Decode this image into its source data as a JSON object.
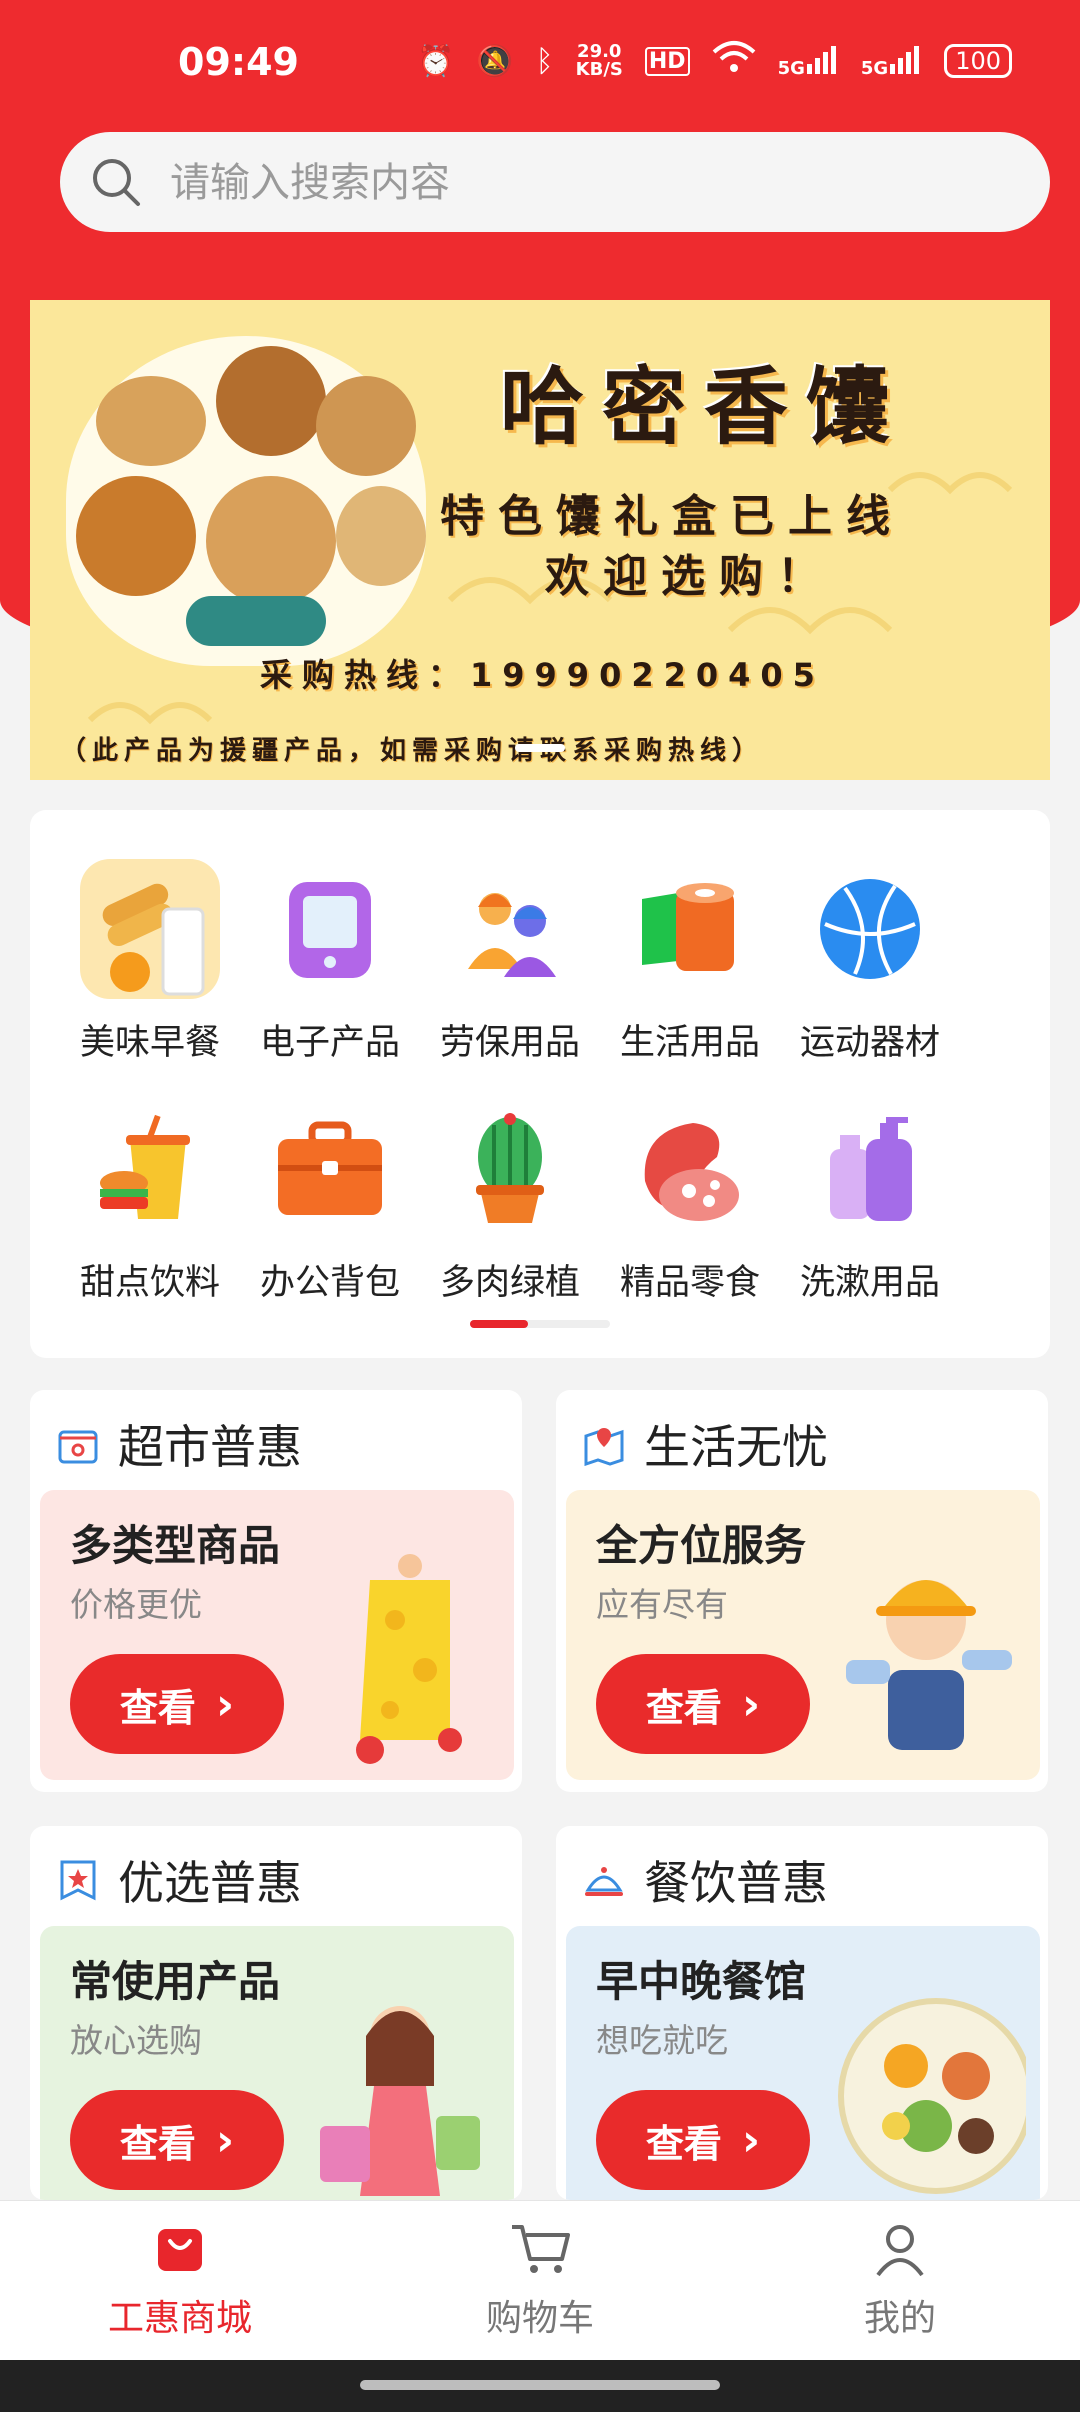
{
  "status": {
    "time": "09:49",
    "net_speed_value": "29.0",
    "net_speed_unit": "KB/S",
    "hd": "HD",
    "sim1": "5G",
    "sim2": "5G",
    "battery": "100"
  },
  "search": {
    "placeholder": "请输入搜索内容"
  },
  "banner": {
    "title": "哈密香馕",
    "line1": "特色馕礼盒已上线",
    "line2": "欢迎选购！",
    "hotline": "采购热线：19990220405",
    "note": "（此产品为援疆产品，如需采购请联系采购热线）"
  },
  "categories": [
    {
      "label": "美味早餐",
      "icon": "breakfast-icon"
    },
    {
      "label": "电子产品",
      "icon": "tablet-icon"
    },
    {
      "label": "劳保用品",
      "icon": "worker-helmet-icon"
    },
    {
      "label": "生活用品",
      "icon": "paper-roll-icon"
    },
    {
      "label": "运动器材",
      "icon": "ball-icon"
    },
    {
      "label": "甜点饮料",
      "icon": "drink-burger-icon"
    },
    {
      "label": "办公背包",
      "icon": "briefcase-icon"
    },
    {
      "label": "多肉绿植",
      "icon": "cactus-icon"
    },
    {
      "label": "精品零食",
      "icon": "meat-snack-icon"
    },
    {
      "label": "洗漱用品",
      "icon": "bottles-icon"
    }
  ],
  "cards": [
    {
      "title": "超市普惠",
      "t1": "多类型商品",
      "t2": "价格更优",
      "btn": "查看",
      "icon": "store-icon",
      "illus": "cheese-illustration"
    },
    {
      "title": "生活无忧",
      "t1": "全方位服务",
      "t2": "应有尽有",
      "btn": "查看",
      "icon": "map-pin-icon",
      "illus": "worker-illustration"
    },
    {
      "title": "优选普惠",
      "t1": "常使用产品",
      "t2": "放心选购",
      "btn": "查看",
      "icon": "bookmark-star-icon",
      "illus": "shopper-illustration"
    },
    {
      "title": "餐饮普惠",
      "t1": "早中晚餐馆",
      "t2": "想吃就吃",
      "btn": "查看",
      "icon": "food-cloche-icon",
      "illus": "salad-plate-illustration"
    }
  ],
  "tabs": [
    {
      "label": "工惠商城",
      "active": true,
      "icon": "shopping-bag-icon"
    },
    {
      "label": "购物车",
      "active": false,
      "icon": "cart-icon"
    },
    {
      "label": "我的",
      "active": false,
      "icon": "person-icon"
    }
  ],
  "colors": {
    "brand_red": "#ee2b2f",
    "active_tab": "#e8262c",
    "inactive_tab": "#777777"
  }
}
